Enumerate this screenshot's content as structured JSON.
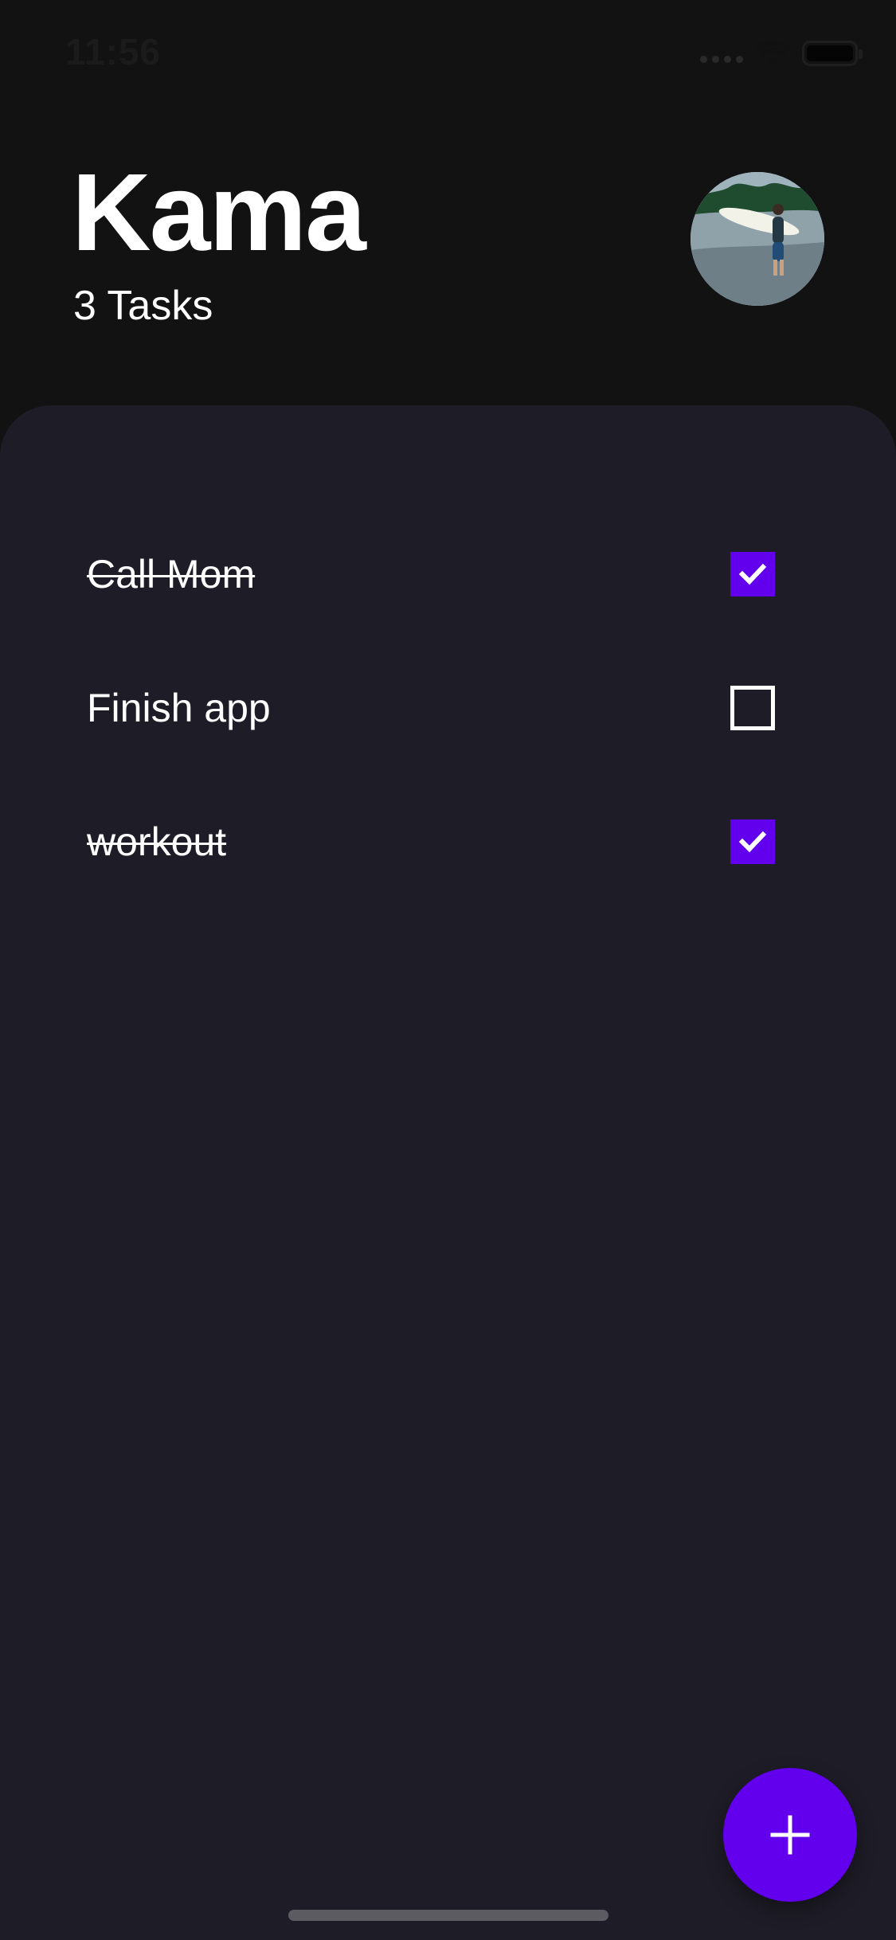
{
  "status_bar": {
    "time": "11:56",
    "signal_icon": "cellular-signal-icon",
    "wifi_icon": "wifi-icon",
    "battery_icon": "battery-icon",
    "battery_level": 1.0
  },
  "header": {
    "title": "Kama",
    "task_count": "3 Tasks",
    "avatar_icon": "profile-photo"
  },
  "tasks": [
    {
      "title": "Call Mom",
      "completed": true
    },
    {
      "title": "Finish app",
      "completed": false
    },
    {
      "title": "workout",
      "completed": true
    }
  ],
  "fab": {
    "icon": "plus-icon"
  },
  "colors": {
    "background": "#121212",
    "panel": "#1e1c26",
    "accent": "#6200ee",
    "text": "#ffffff"
  }
}
